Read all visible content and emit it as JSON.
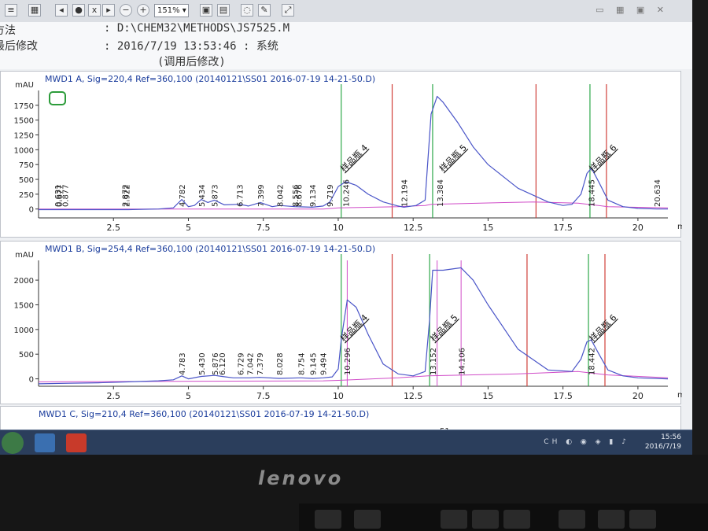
{
  "window": {
    "zoom": "151%",
    "header": {
      "method_prefix": "方法",
      "method_line": ":  D:\\CHEM32\\METHODS\\JS7525.M",
      "modified_prefix": "最后修改",
      "modified_line": ":  2016/7/19 13:53:46  :   系统",
      "modified_note": "(调用后修改)"
    }
  },
  "colors": {
    "signal": "#4a55c8",
    "baseline": "#d04cc8",
    "marker_green": "#2ea84a",
    "marker_red": "#d0403a",
    "axis": "#333333",
    "label_blue": "#1a3c9c"
  },
  "chart_data": [
    {
      "type": "line",
      "title": "MWD1 A, Sig=220,4 Ref=360,100 (20140121\\SS01 2016-07-19 14-21-50.D)",
      "ylabel": "mAU",
      "xlabel": "min",
      "xlim": [
        0,
        21
      ],
      "ylim": [
        -150,
        2000
      ],
      "xticks": [
        2.5,
        5,
        7.5,
        10,
        12.5,
        15,
        17.5,
        20
      ],
      "xtick_labels": [
        "2.5",
        "5",
        "7.5",
        "10",
        "12.5",
        "15",
        "17.5",
        "20"
      ],
      "yticks": [
        0,
        250,
        500,
        750,
        1000,
        1250,
        1500,
        1750
      ],
      "ytick_labels": [
        "0",
        "250",
        "500",
        "750",
        "1000",
        "1250",
        "1500",
        "1750"
      ],
      "signal": {
        "x": [
          0,
          0.5,
          1.0,
          2.0,
          3.0,
          4.0,
          4.5,
          4.78,
          5.0,
          5.2,
          5.43,
          5.65,
          5.87,
          6.2,
          6.71,
          7.0,
          7.4,
          7.8,
          8.04,
          8.56,
          9.13,
          9.5,
          9.72,
          10.0,
          10.25,
          10.6,
          11.0,
          11.5,
          12.0,
          12.19,
          12.6,
          12.9,
          13.1,
          13.3,
          13.5,
          14.0,
          14.5,
          15.0,
          16.0,
          17.0,
          17.5,
          17.8,
          18.1,
          18.3,
          18.45,
          18.7,
          19.0,
          19.5,
          20.0,
          20.63,
          21.0
        ],
        "y": [
          -10,
          -10,
          -10,
          -10,
          -10,
          0,
          20,
          160,
          40,
          60,
          160,
          110,
          150,
          70,
          80,
          50,
          110,
          40,
          60,
          40,
          30,
          50,
          120,
          380,
          460,
          400,
          250,
          120,
          50,
          30,
          60,
          150,
          1600,
          1900,
          1800,
          1450,
          1050,
          750,
          350,
          120,
          60,
          80,
          250,
          600,
          690,
          450,
          150,
          40,
          10,
          0,
          0
        ]
      },
      "baseline": {
        "x": [
          0,
          9.5,
          10.0,
          12.0,
          12.9,
          13.1,
          16.5,
          18.0,
          19.0,
          21.0
        ],
        "y": [
          0,
          0,
          20,
          40,
          60,
          80,
          120,
          100,
          40,
          20
        ]
      },
      "green_markers": [
        10.1,
        13.15,
        18.4
      ],
      "red_markers": [
        11.8,
        16.6,
        18.95
      ],
      "peak_labels": [
        {
          "rt": 0.631,
          "text": "0.631"
        },
        {
          "rt": 0.677,
          "text": "0.677"
        },
        {
          "rt": 0.877,
          "text": "0.877"
        },
        {
          "rt": 2.872,
          "text": "2.872"
        },
        {
          "rt": 2.922,
          "text": "2.922"
        },
        {
          "rt": 4.782,
          "text": "4.782"
        },
        {
          "rt": 5.434,
          "text": "5.434"
        },
        {
          "rt": 5.873,
          "text": "5.873"
        },
        {
          "rt": 6.713,
          "text": "6.713"
        },
        {
          "rt": 7.399,
          "text": "7.399"
        },
        {
          "rt": 8.042,
          "text": "8.042"
        },
        {
          "rt": 8.556,
          "text": "8.556"
        },
        {
          "rt": 8.676,
          "text": "8.676"
        },
        {
          "rt": 9.134,
          "text": "9.134"
        },
        {
          "rt": 9.719,
          "text": "9.719"
        },
        {
          "rt": 10.246,
          "text": "10.246"
        },
        {
          "rt": 12.194,
          "text": "12.194"
        },
        {
          "rt": 13.384,
          "text": "13.384"
        },
        {
          "rt": 18.445,
          "text": "18.445"
        },
        {
          "rt": 20.634,
          "text": "20.634"
        }
      ],
      "compound_labels": [
        {
          "rt": 10.3,
          "text": "样品瓶 4"
        },
        {
          "rt": 13.6,
          "text": "样品瓶 5"
        },
        {
          "rt": 18.6,
          "text": "样品瓶 6"
        }
      ]
    },
    {
      "type": "line",
      "title": "MWD1 B, Sig=254,4 Ref=360,100 (20140121\\SS01 2016-07-19 14-21-50.D)",
      "ylabel": "mAU",
      "xlabel": "min",
      "xlim": [
        0,
        21
      ],
      "ylim": [
        -150,
        2400
      ],
      "xticks": [
        2.5,
        5,
        7.5,
        10,
        12.5,
        15,
        17.5,
        20
      ],
      "xtick_labels": [
        "2.5",
        "5",
        "7.5",
        "10",
        "12.5",
        "15",
        "17.5",
        "20"
      ],
      "yticks": [
        0,
        500,
        1000,
        1500,
        2000
      ],
      "ytick_labels": [
        "0",
        "500",
        "1000",
        "1500",
        "2000"
      ],
      "signal": {
        "x": [
          0,
          1.0,
          2.0,
          3.0,
          4.0,
          4.5,
          4.78,
          5.0,
          5.43,
          5.88,
          6.12,
          6.5,
          6.73,
          7.04,
          7.38,
          8.03,
          8.75,
          9.15,
          9.5,
          9.8,
          10.0,
          10.1,
          10.3,
          10.6,
          11.0,
          11.5,
          12.0,
          12.5,
          12.9,
          13.05,
          13.15,
          13.5,
          14.1,
          14.5,
          15.0,
          16.0,
          17.0,
          17.8,
          18.1,
          18.3,
          18.44,
          18.7,
          19.0,
          19.5,
          20.0,
          21.0
        ],
        "y": [
          -100,
          -90,
          -80,
          -60,
          -40,
          -20,
          60,
          0,
          50,
          70,
          50,
          20,
          20,
          20,
          30,
          10,
          20,
          10,
          20,
          40,
          200,
          800,
          1600,
          1450,
          900,
          300,
          100,
          60,
          150,
          1200,
          2200,
          2200,
          2250,
          2000,
          1500,
          600,
          180,
          150,
          400,
          750,
          790,
          500,
          180,
          60,
          20,
          0
        ]
      },
      "baseline": {
        "x": [
          0,
          9.5,
          10.0,
          12.0,
          13.0,
          16.0,
          18.0,
          19.0,
          21.0
        ],
        "y": [
          -60,
          -40,
          -30,
          20,
          60,
          100,
          150,
          80,
          20
        ]
      },
      "green_markers": [
        10.1,
        13.05,
        18.35
      ],
      "red_markers": [
        11.8,
        16.3,
        18.9
      ],
      "pink_markers": [
        10.3,
        13.3,
        14.1
      ],
      "peak_labels": [
        {
          "rt": 4.783,
          "text": "4.783"
        },
        {
          "rt": 5.43,
          "text": "5.430"
        },
        {
          "rt": 5.876,
          "text": "5.876"
        },
        {
          "rt": 6.12,
          "text": "6.120"
        },
        {
          "rt": 6.729,
          "text": "6.729"
        },
        {
          "rt": 7.042,
          "text": "7.042"
        },
        {
          "rt": 7.379,
          "text": "7.379"
        },
        {
          "rt": 8.028,
          "text": "8.028"
        },
        {
          "rt": 8.754,
          "text": "8.754"
        },
        {
          "rt": 9.145,
          "text": "9.145"
        },
        {
          "rt": 9.494,
          "text": "9.494"
        },
        {
          "rt": 10.296,
          "text": "10.296"
        },
        {
          "rt": 13.152,
          "text": "13.152"
        },
        {
          "rt": 14.106,
          "text": "14.106"
        },
        {
          "rt": 18.442,
          "text": "18.442"
        }
      ],
      "compound_labels": [
        {
          "rt": 10.3,
          "text": "样品瓶 4"
        },
        {
          "rt": 13.3,
          "text": "样品瓶 5"
        },
        {
          "rt": 18.6,
          "text": "样品瓶 6"
        }
      ]
    },
    {
      "type": "line",
      "title": "MWD1 C, Sig=210,4 Ref=360,100 (20140121\\SS01 2016-07-19 14-21-50.D)",
      "visible_fragment": "51"
    }
  ],
  "taskbar": {
    "time": "15:56",
    "date": "2016/7/19",
    "tray": "CH"
  },
  "bezel": {
    "brand": "lenovo"
  }
}
